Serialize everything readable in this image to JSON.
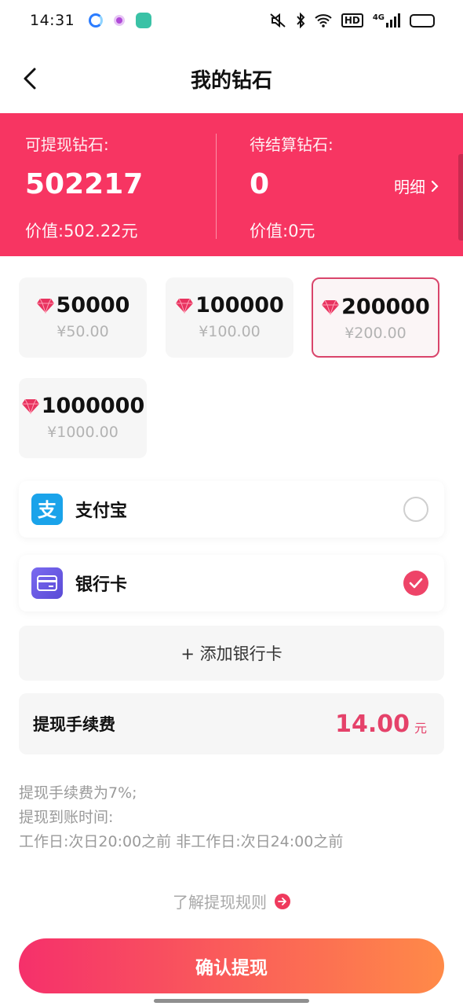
{
  "status_bar": {
    "time": "14:31",
    "icons": [
      "mute-icon",
      "bluetooth-icon",
      "wifi-icon",
      "hd-icon",
      "signal-4g-icon",
      "battery-icon"
    ],
    "hd_label": "HD",
    "network_label": "4G",
    "battery_level": 0.35
  },
  "nav": {
    "title": "我的钻石",
    "back_icon": "chevron-left-icon"
  },
  "banner": {
    "withdrawable_label": "可提现钻石:",
    "withdrawable_amount": "502217",
    "withdrawable_value": "价值:502.22元",
    "pending_label": "待结算钻石:",
    "pending_amount": "0",
    "pending_value": "价值:0元",
    "detail_label": "明细",
    "color": "#f73562"
  },
  "options": [
    {
      "diamonds": "50000",
      "price": "¥50.00",
      "selected": false
    },
    {
      "diamonds": "100000",
      "price": "¥100.00",
      "selected": false
    },
    {
      "diamonds": "200000",
      "price": "¥200.00",
      "selected": true
    },
    {
      "diamonds": "1000000",
      "price": "¥1000.00",
      "selected": false
    }
  ],
  "payment_methods": [
    {
      "label": "支付宝",
      "icon": "alipay-icon",
      "checked": false
    },
    {
      "label": "银行卡",
      "icon": "bank-card-icon",
      "checked": true
    }
  ],
  "add_card_label": "+ 添加银行卡",
  "fee": {
    "label": "提现手续费",
    "amount": "14.00",
    "unit": "元"
  },
  "notes": [
    "提现手续费为7%;",
    "提现到账时间:",
    "工作日:次日20:00之前 非工作日:次日24:00之前"
  ],
  "rules_link": "了解提现规则",
  "confirm_label": "确认提现",
  "accent_color": "#e5426a"
}
